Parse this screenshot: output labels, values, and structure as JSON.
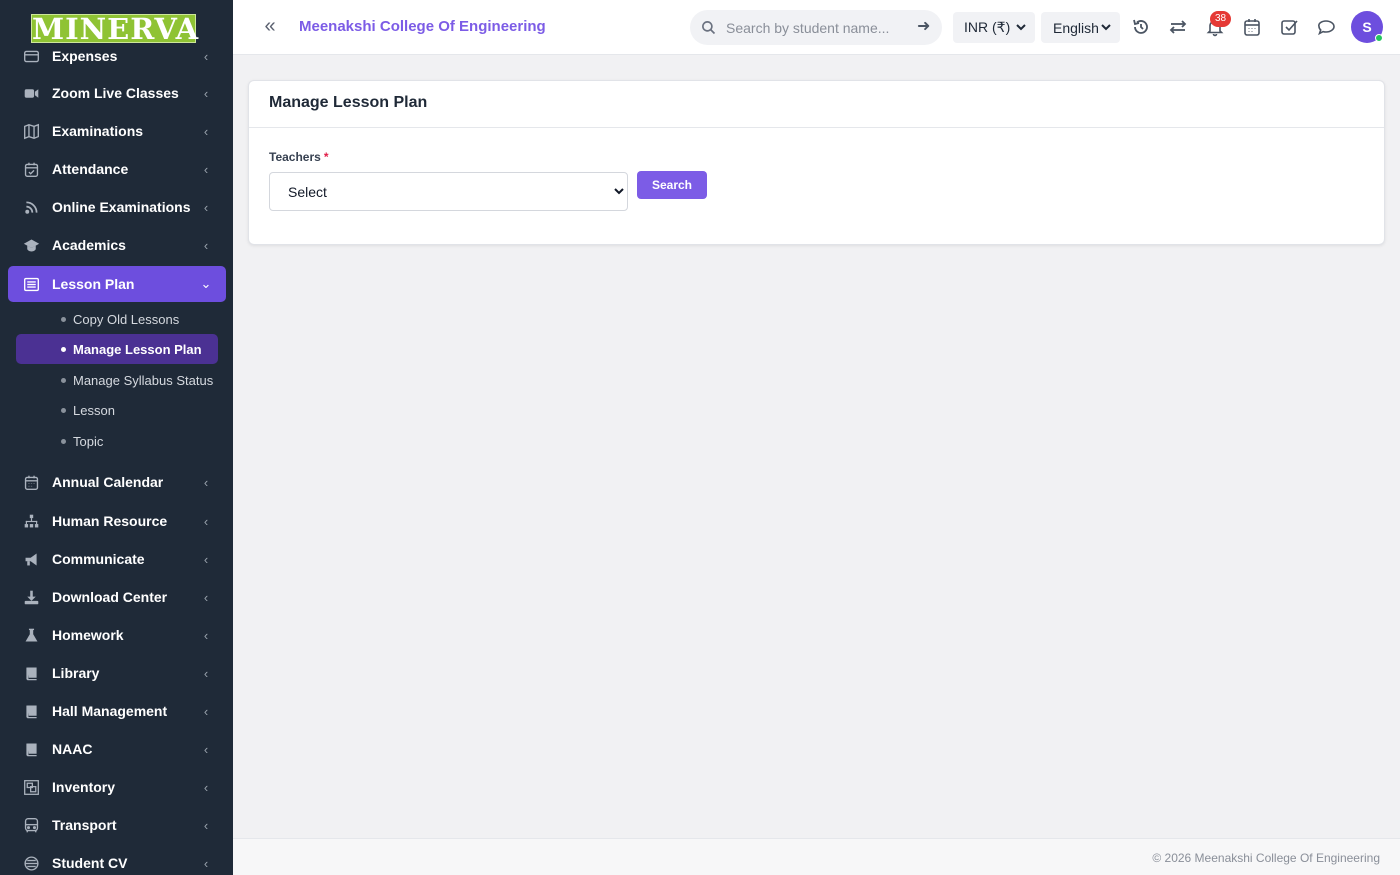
{
  "sidebar": {
    "logo_text": "MINERVA",
    "items": [
      {
        "label": "Expenses",
        "icon": "credit-card-icon",
        "chevron": "‹"
      },
      {
        "label": "Zoom Live Classes",
        "icon": "video-icon",
        "chevron": "‹"
      },
      {
        "label": "Examinations",
        "icon": "map-icon",
        "chevron": "‹"
      },
      {
        "label": "Attendance",
        "icon": "calendar-check-icon",
        "chevron": "‹"
      },
      {
        "label": "Online Examinations",
        "icon": "rss-icon",
        "chevron": "‹"
      },
      {
        "label": "Academics",
        "icon": "graduation-cap-icon",
        "chevron": "‹"
      },
      {
        "label": "Lesson Plan",
        "icon": "list-alt-icon",
        "chevron": "⌄"
      },
      {
        "label": "Annual Calendar",
        "icon": "calendar-icon",
        "chevron": "‹"
      },
      {
        "label": "Human Resource",
        "icon": "sitemap-icon",
        "chevron": "‹"
      },
      {
        "label": "Communicate",
        "icon": "bullhorn-icon",
        "chevron": "‹"
      },
      {
        "label": "Download Center",
        "icon": "download-icon",
        "chevron": "‹"
      },
      {
        "label": "Homework",
        "icon": "flask-icon",
        "chevron": "‹"
      },
      {
        "label": "Library",
        "icon": "book-icon",
        "chevron": "‹"
      },
      {
        "label": "Hall Management",
        "icon": "book-icon",
        "chevron": "‹"
      },
      {
        "label": "NAAC",
        "icon": "book-icon",
        "chevron": "‹"
      },
      {
        "label": "Inventory",
        "icon": "object-group-icon",
        "chevron": "‹"
      },
      {
        "label": "Transport",
        "icon": "bus-icon",
        "chevron": "‹"
      },
      {
        "label": "Student CV",
        "icon": "id-badge-icon",
        "chevron": "‹"
      }
    ],
    "lesson_plan_sub": [
      {
        "label": "Copy Old Lessons"
      },
      {
        "label": "Manage Lesson Plan"
      },
      {
        "label": "Manage Syllabus Status"
      },
      {
        "label": "Lesson"
      },
      {
        "label": "Topic"
      }
    ]
  },
  "topbar": {
    "collapse_glyph": "«",
    "college_name": "Meenakshi College Of Engineering",
    "search_placeholder": "Search by student name...",
    "search_go_glyph": "➜",
    "currency": "INR (₹)",
    "language": "English",
    "notification_count": "38",
    "avatar_initial": "S",
    "accent": "#7c5ce6"
  },
  "main": {
    "card_title": "Manage Lesson Plan",
    "teachers_label": "Teachers",
    "required_mark": "*",
    "teachers_select_value": "Select",
    "search_button": "Search"
  },
  "footer": {
    "copyright": "© 2026 Meenakshi College Of Engineering"
  },
  "colors": {
    "sidebar_bg": "#1f2a38",
    "active_item": "#6d4ede",
    "active_sub": "#4b3193",
    "badge": "#e53935"
  }
}
